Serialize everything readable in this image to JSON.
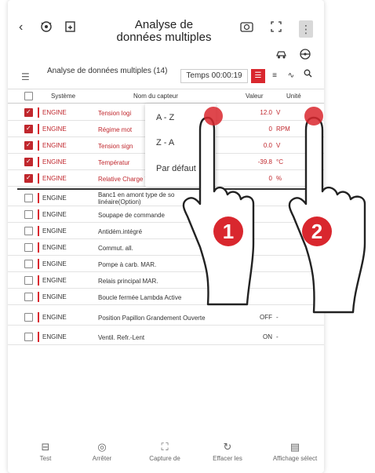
{
  "header": {
    "title": "Analyse de données multiples",
    "icons": [
      "back-icon",
      "vehicle-scan-icon",
      "report-icon",
      "camera-icon",
      "fullscreen-icon",
      "more-icon",
      "car-settings-icon",
      "steering-wheel-icon"
    ]
  },
  "panel": {
    "name": "Analyse de données multiples (14)",
    "timer": "Temps 00:00:19",
    "view_buttons": [
      "list",
      "text",
      "graph",
      "search"
    ]
  },
  "columns": {
    "system": "Système",
    "sensor": "Nom du capteur",
    "value": "Valeur",
    "unit": "Unité"
  },
  "rows": [
    {
      "checked": true,
      "system": "ENGINE",
      "sensor": "Tension logi",
      "value": "12.0",
      "unit": "V"
    },
    {
      "checked": true,
      "system": "ENGINE",
      "sensor": "Régime mot",
      "value": "0",
      "unit": "RPM"
    },
    {
      "checked": true,
      "system": "ENGINE",
      "sensor": "Tension sign",
      "value": "0.0",
      "unit": "V"
    },
    {
      "checked": true,
      "system": "ENGINE",
      "sensor": "Températur",
      "value": "-39.8",
      "unit": "°C"
    },
    {
      "checked": true,
      "system": "ENGINE",
      "sensor": "Relative Charge Value (Engine L",
      "value": "0",
      "unit": "%"
    },
    {
      "checked": false,
      "system": "ENGINE",
      "sensor": "Banc1 en amont type de so linéaire(Option)",
      "value": "",
      "unit": ""
    },
    {
      "checked": false,
      "system": "ENGINE",
      "sensor": "Soupape de commande",
      "value": "",
      "unit": ""
    },
    {
      "checked": false,
      "system": "ENGINE",
      "sensor": "Antidém.intégré",
      "value": "",
      "unit": ""
    },
    {
      "checked": false,
      "system": "ENGINE",
      "sensor": "Commut. all.",
      "value": "",
      "unit": ""
    },
    {
      "checked": false,
      "system": "ENGINE",
      "sensor": "Pompe à carb. MAR.",
      "value": "",
      "unit": ""
    },
    {
      "checked": false,
      "system": "ENGINE",
      "sensor": "Relais principal MAR.",
      "value": "",
      "unit": ""
    },
    {
      "checked": false,
      "system": "ENGINE",
      "sensor": "Boucle fermée Lambda Active",
      "value": "",
      "unit": ""
    },
    {
      "checked": false,
      "system": "ENGINE",
      "sensor": "Position Papillon Grandement Ouverte",
      "value": "OFF",
      "unit": "-"
    },
    {
      "checked": false,
      "system": "ENGINE",
      "sensor": "Ventil. Refr.-Lent",
      "value": "ON",
      "unit": "-"
    }
  ],
  "sort_menu": {
    "options": [
      "A - Z",
      "Z - A",
      "Par défaut"
    ]
  },
  "steps": [
    "1",
    "2"
  ],
  "bottom_bar": {
    "items": [
      {
        "label": "Test",
        "icon": "test-icon"
      },
      {
        "label": "Arrêter",
        "icon": "stop-icon"
      },
      {
        "label": "Capture de",
        "icon": "capture-icon"
      },
      {
        "label": "Effacer les",
        "icon": "clear-icon"
      },
      {
        "label": "Affichage sélect",
        "icon": "display-select-icon"
      }
    ]
  },
  "colors": {
    "accent": "#d9272e"
  }
}
